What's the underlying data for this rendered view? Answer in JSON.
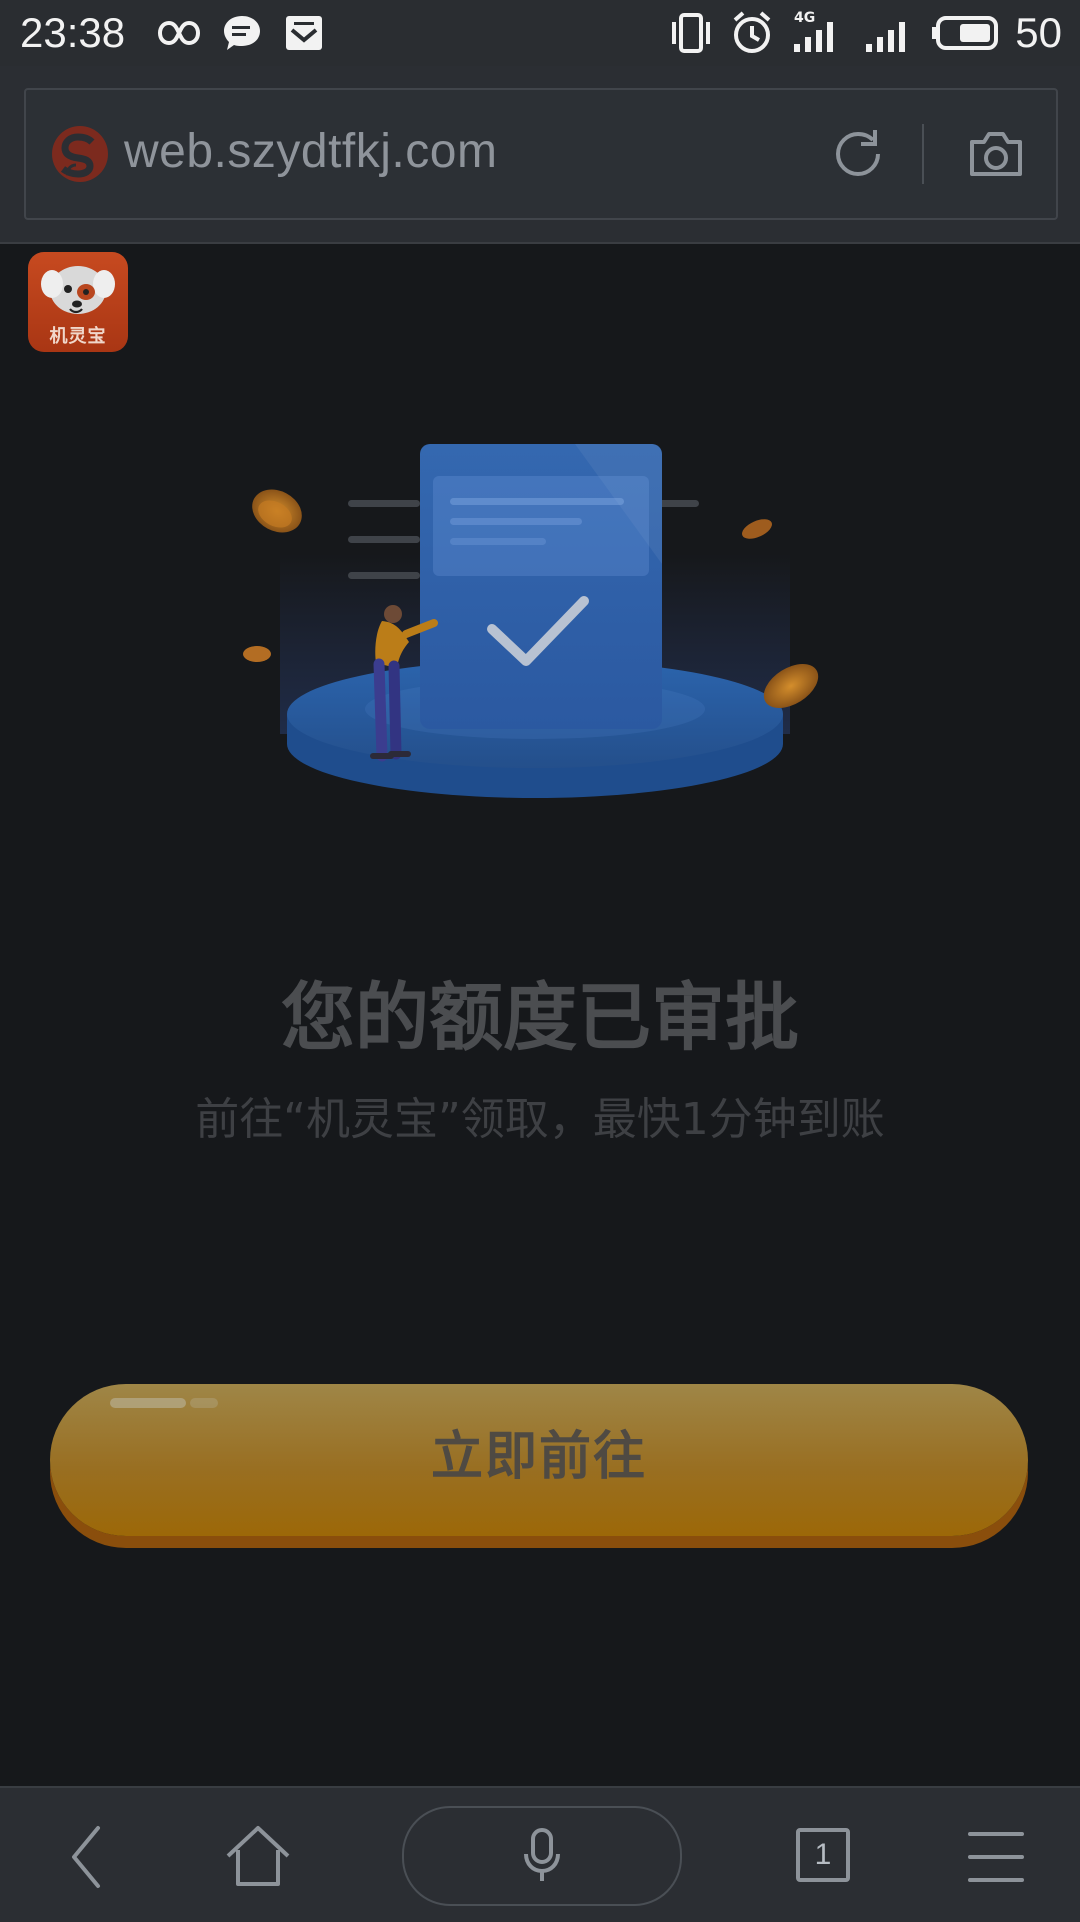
{
  "status_bar": {
    "time": "23:38",
    "network_label": "4G",
    "battery_text": "50",
    "icons": [
      "infinity-icon",
      "chat-bubble-icon",
      "mail-icon",
      "vibrate-icon",
      "alarm-icon",
      "signal-4g-icon",
      "signal-icon",
      "battery-icon"
    ]
  },
  "browser": {
    "url": "web.szydtfkj.com",
    "site_icon": "sogou-logo-icon",
    "actions": [
      "refresh-icon",
      "camera-icon"
    ]
  },
  "page": {
    "logo_text": "机灵宝",
    "headline": "您的额度已审批",
    "subline": "前往“机灵宝”领取，最快1分钟到账",
    "cta_label": "立即前往",
    "colors": {
      "background": "#16181b",
      "cta_top": "#9f8647",
      "cta_bottom": "#9c6808",
      "card_blue": "#2e63ac"
    }
  },
  "bottom_nav": {
    "items": [
      "back-icon",
      "home-icon",
      "microphone-icon",
      "tabs-icon",
      "menu-icon"
    ],
    "tab_count": "1"
  }
}
